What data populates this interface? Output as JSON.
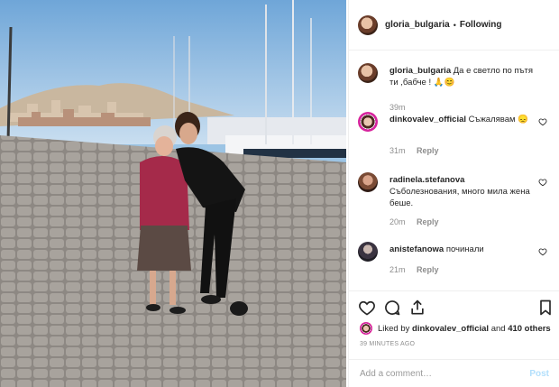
{
  "header": {
    "username": "gloria_bulgaria",
    "separator": "•",
    "follow_status": "Following"
  },
  "comments": [
    {
      "username": "gloria_bulgaria",
      "text": "Да е светло по пътя ти ,бабче ! 🙏😊",
      "time": "39m",
      "reply": ""
    },
    {
      "username": "dinkovalev_official",
      "text": "Съжалявам 😞",
      "time": "31m",
      "reply": "Reply"
    },
    {
      "username": "radinela.stefanova",
      "text": "Съболезнования, много мила жена беше.",
      "time": "20m",
      "reply": "Reply"
    },
    {
      "username": "anistefanowa",
      "text": "починали",
      "time": "21m",
      "reply": "Reply"
    }
  ],
  "likes": {
    "prefix": "Liked by",
    "user": "dinkovalev_official",
    "and": "and",
    "others": "410 others"
  },
  "timestamp": "39 MINUTES AGO",
  "add_comment": {
    "placeholder": "Add a comment…",
    "post_label": "Post"
  },
  "icons": [
    "heart-icon",
    "comment-icon",
    "share-icon",
    "bookmark-icon"
  ],
  "colors": {
    "text": "#262626",
    "muted": "#8e8e8e",
    "post_disabled": "#b2dffc",
    "border": "#efefef"
  }
}
